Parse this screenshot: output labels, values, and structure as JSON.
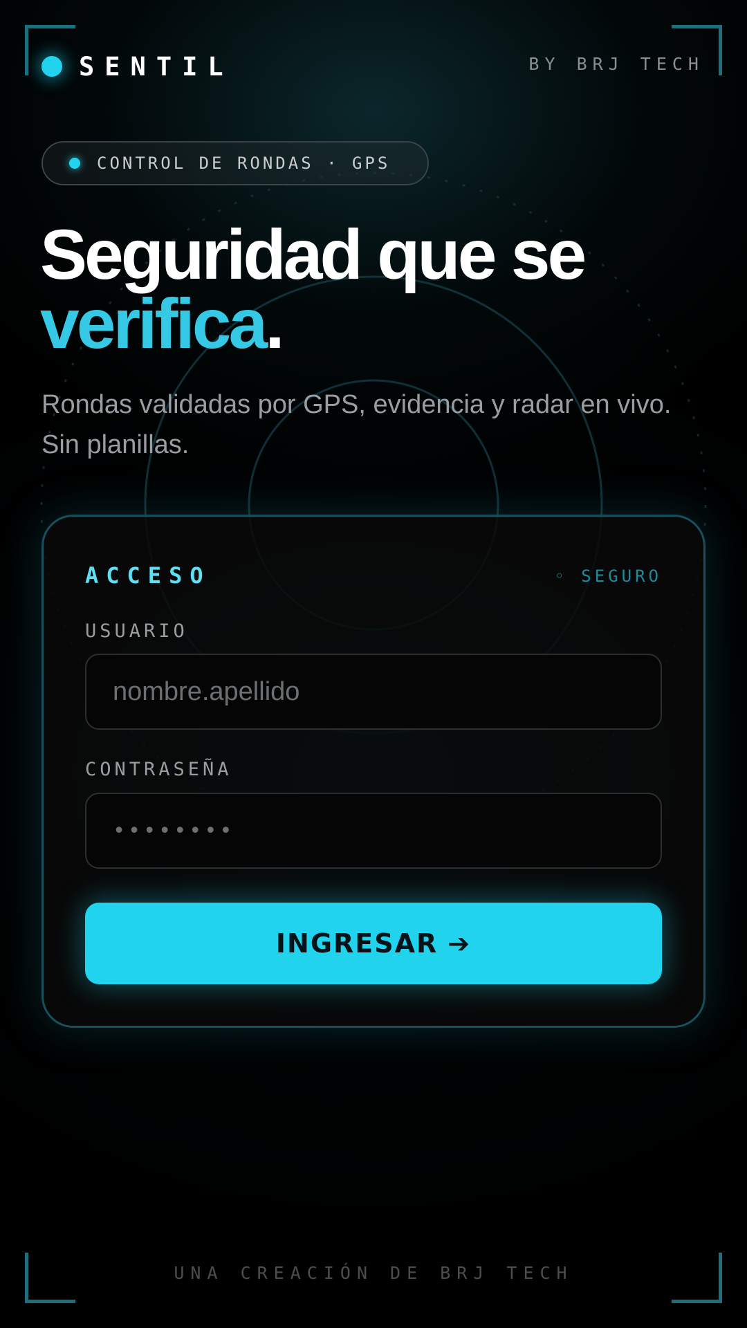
{
  "header": {
    "brand_name": "SENTIL",
    "byline": "BY BRJ TECH"
  },
  "hero": {
    "tag": "CONTROL DE RONDAS · GPS",
    "headline_line1": "Seguridad que se",
    "headline_accent": "verifica",
    "headline_end": ".",
    "subtitle": "Rondas validadas por GPS, evidencia y radar en vivo. Sin planillas."
  },
  "login": {
    "title": "ACCESO",
    "status": "◦ SEGURO",
    "username_label": "USUARIO",
    "username_placeholder": "nombre.apellido",
    "username_value": "",
    "password_label": "CONTRASEÑA",
    "password_placeholder": "••••••••",
    "password_value": "",
    "submit_label": "INGRESAR",
    "submit_arrow": "➔"
  },
  "footer": {
    "text": "UNA CREACIÓN DE BRJ TECH"
  },
  "colors": {
    "accent": "#22d3ee",
    "accent_text": "#5fe0f2",
    "background": "#000000",
    "card_border": "#17505a",
    "corner": "#1d6f7c"
  },
  "icons": {
    "brand": "brand-dot-icon",
    "tag": "status-dot-icon",
    "submit": "arrow-right-icon"
  }
}
